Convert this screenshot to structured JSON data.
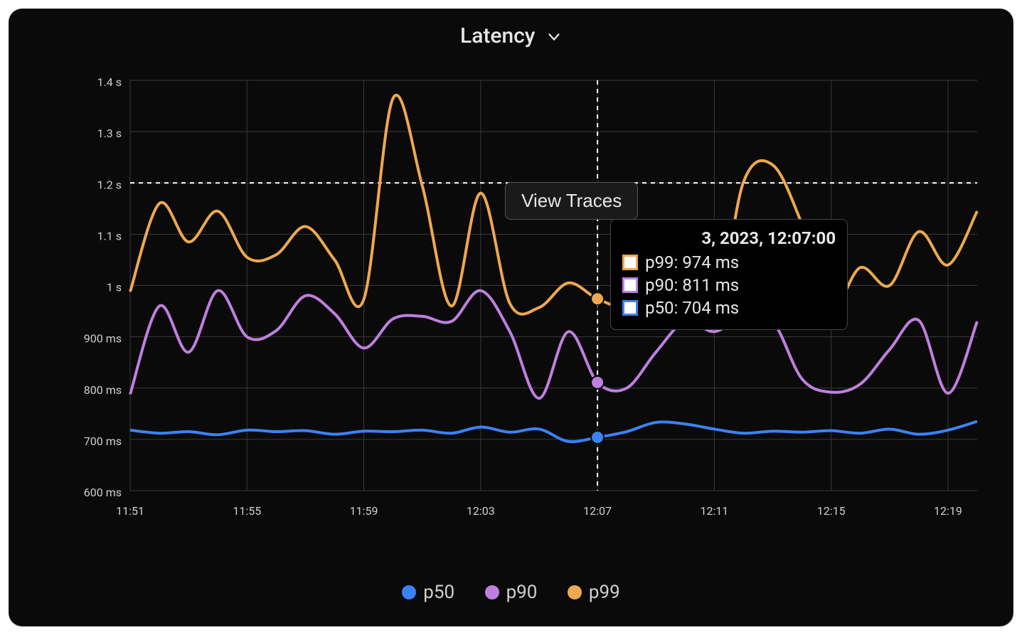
{
  "title": "Latency",
  "view_traces_label": "View Traces",
  "tooltip": {
    "timestamp": "3, 2023, 12:07:00",
    "rows": [
      {
        "label": "p99: 974 ms",
        "color": "#eea84f"
      },
      {
        "label": "p90: 811 ms",
        "color": "#c07fe0"
      },
      {
        "label": "p50: 704 ms",
        "color": "#3b82f6"
      }
    ]
  },
  "legend": [
    {
      "name": "p50",
      "color": "#3b82f6"
    },
    {
      "name": "p90",
      "color": "#c07fe0"
    },
    {
      "name": "p99",
      "color": "#eea84f"
    }
  ],
  "cursor_time": "12:07",
  "chart_data": {
    "type": "line",
    "title": "Latency",
    "ylabel": "",
    "xlabel": "",
    "baseline_ms": 1200,
    "y_ticks_ms": [
      600,
      700,
      800,
      900,
      1000,
      1100,
      1200,
      1300,
      1400
    ],
    "y_tick_labels": [
      "600 ms",
      "700 ms",
      "800 ms",
      "900 ms",
      "1 s",
      "1.1 s",
      "1.2 s",
      "1.3 s",
      "1.4 s"
    ],
    "x_ticks": [
      "11:51",
      "11:55",
      "11:59",
      "12:03",
      "12:07",
      "12:11",
      "12:15",
      "12:19"
    ],
    "x": [
      "11:51",
      "11:52",
      "11:53",
      "11:54",
      "11:55",
      "11:56",
      "11:57",
      "11:58",
      "11:59",
      "12:00",
      "12:01",
      "12:02",
      "12:03",
      "12:04",
      "12:05",
      "12:06",
      "12:07",
      "12:08",
      "12:09",
      "12:10",
      "12:11",
      "12:12",
      "12:13",
      "12:14",
      "12:15",
      "12:16",
      "12:17",
      "12:18",
      "12:19",
      "12:20"
    ],
    "series": [
      {
        "name": "p50",
        "color": "#3b82f6",
        "values": [
          718,
          712,
          715,
          709,
          718,
          715,
          717,
          710,
          716,
          715,
          718,
          712,
          724,
          714,
          720,
          696,
          704,
          715,
          733,
          730,
          720,
          712,
          716,
          714,
          717,
          712,
          720,
          710,
          718,
          735
        ]
      },
      {
        "name": "p90",
        "color": "#c07fe0",
        "values": [
          788,
          960,
          870,
          990,
          900,
          912,
          980,
          945,
          878,
          935,
          940,
          930,
          990,
          910,
          780,
          910,
          811,
          800,
          870,
          930,
          910,
          940,
          930,
          818,
          792,
          808,
          875,
          932,
          790,
          930
        ]
      },
      {
        "name": "p99",
        "color": "#eea84f",
        "values": [
          988,
          1160,
          1085,
          1145,
          1055,
          1060,
          1115,
          1050,
          973,
          1365,
          1195,
          960,
          1180,
          965,
          957,
          1005,
          974,
          960,
          1010,
          1125,
          940,
          1202,
          1235,
          1120,
          960,
          1035,
          1000,
          1105,
          1040,
          1145
        ]
      }
    ],
    "ylim": [
      600,
      1400
    ]
  }
}
